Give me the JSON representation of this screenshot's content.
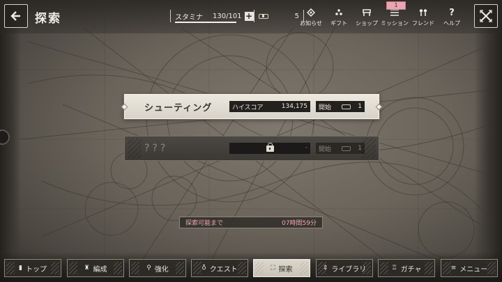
{
  "header": {
    "title": "探索",
    "stamina": {
      "label": "スタミナ",
      "value": "130/101",
      "fill_percent": 100
    },
    "ticket_count": "5",
    "menu": [
      {
        "label": "お知らせ",
        "icon": "diamond-icon"
      },
      {
        "label": "ギフト",
        "icon": "gift-icon"
      },
      {
        "label": "ショップ",
        "icon": "shop-icon"
      },
      {
        "label": "ミッション",
        "icon": "mission-icon"
      },
      {
        "label": "フレンド",
        "icon": "friend-icon"
      },
      {
        "label": "ヘルプ",
        "icon": "help-icon"
      }
    ],
    "mission_badge": "1"
  },
  "modes": [
    {
      "name": "シューティング",
      "score_label": "ハイスコア",
      "score_value": "134,175",
      "start_label": "開始",
      "ticket_cost": "1",
      "locked": false
    },
    {
      "name": "???",
      "score_value": "-",
      "start_label": "開始",
      "ticket_cost": "1",
      "locked": true
    }
  ],
  "timer": {
    "label": "探索可能まで",
    "value": "07時間59分"
  },
  "bottom_nav": [
    {
      "label": "トップ",
      "icon": "▮"
    },
    {
      "label": "編成",
      "icon": "♜"
    },
    {
      "label": "強化",
      "icon": "⚲"
    },
    {
      "label": "クエスト",
      "icon": "♁"
    },
    {
      "label": "探索",
      "icon": "⛶",
      "active": true
    },
    {
      "label": "ライブラリ",
      "icon": "⇕"
    },
    {
      "label": "ガチャ",
      "icon": "♖"
    },
    {
      "label": "メニュー",
      "icon": "≡"
    }
  ],
  "colors": {
    "accent_pink": "#e8a7b0",
    "card_light": "#ece8df",
    "card_dark": "#3c3935"
  }
}
